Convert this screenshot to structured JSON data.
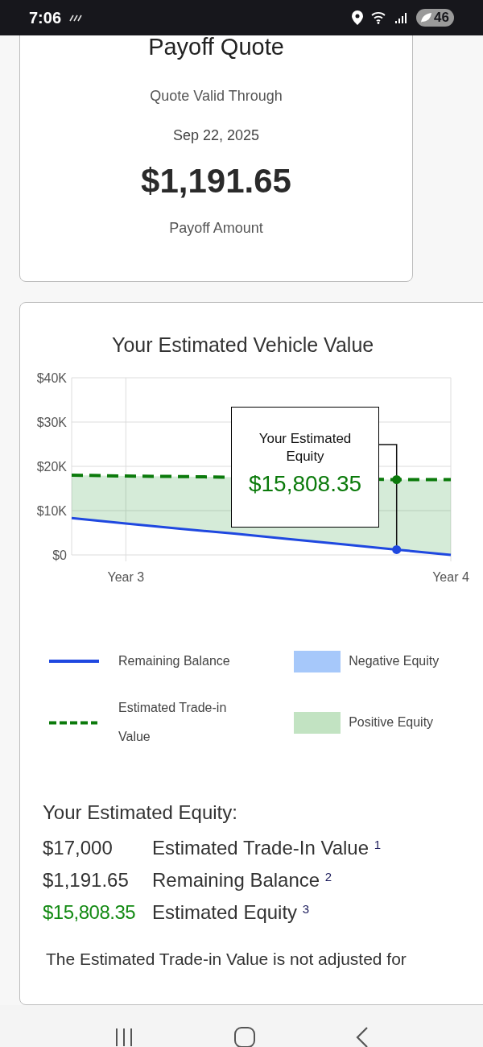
{
  "status_bar": {
    "time": "7:06",
    "battery": "46"
  },
  "payoff_card": {
    "title": "Payoff Quote",
    "valid_label": "Quote Valid Through",
    "valid_date": "Sep 22, 2025",
    "amount": "$1,191.65",
    "amount_label": "Payoff Amount"
  },
  "value_card": {
    "title": "Your Estimated Vehicle Value",
    "chart_data": {
      "type": "line",
      "grid": true,
      "categories": [
        null,
        "Year 3",
        null,
        null,
        null,
        null,
        null,
        "Year 4"
      ],
      "ylim": [
        0,
        40000
      ],
      "yticks": [
        {
          "value": 0,
          "label": "$0"
        },
        {
          "value": 10000,
          "label": "$10K"
        },
        {
          "value": 20000,
          "label": "$20K"
        },
        {
          "value": 30000,
          "label": "$30K"
        },
        {
          "value": 40000,
          "label": "$40K"
        }
      ],
      "series": [
        {
          "name": "Estimated Trade-in Value",
          "color": "#0b7a0b",
          "line_style": "dashed",
          "values": [
            18000,
            17800,
            17700,
            null,
            null,
            null,
            17000,
            17000
          ]
        },
        {
          "name": "Remaining Balance",
          "color": "#1f48e0",
          "line_style": "solid",
          "values": [
            8300,
            7100,
            5900,
            4800,
            3600,
            2400,
            1200,
            0
          ]
        }
      ]
    },
    "tooltip": {
      "title": "Your Estimated Equity",
      "value": "$15,808.35"
    },
    "legend": [
      {
        "label": "Negative Equity",
        "color": "#a6c8fa"
      },
      {
        "label": "Positive Equity",
        "color": "#c2e3c2"
      }
    ]
  },
  "equity_summary": {
    "heading": "Your Estimated Equity:",
    "rows": [
      {
        "kind": "plain",
        "amount": "$17,000",
        "label": "Estimated Trade-In Value $^{1}$"
      },
      {
        "kind": "plain",
        "amount": "$1,191.65",
        "label": "Remaining Balance $^{2}$"
      },
      {
        "kind": "highlight",
        "amount": "$15,808.35",
        "label": "Estimated Equity $^{3}$"
      }
    ],
    "note": "The Estimated Trade-in Value is not adjusted for"
  }
}
